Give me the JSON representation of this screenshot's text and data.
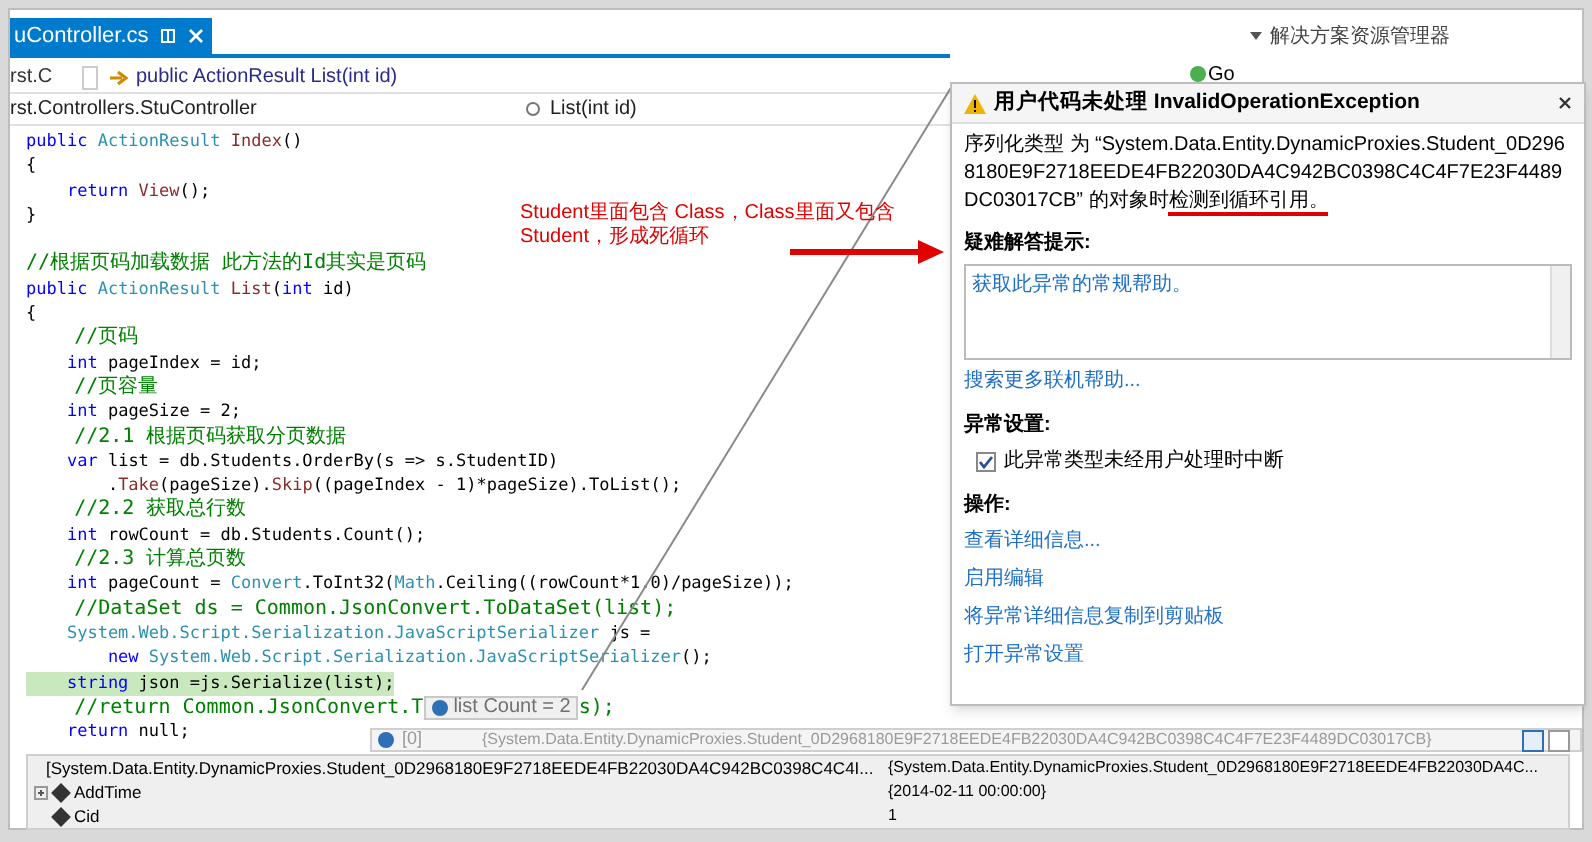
{
  "editor": {
    "tab": {
      "label": "uController.cs",
      "selected": true
    },
    "nav_bar_1": {
      "project": "rst.C",
      "member": "public ActionResult List(int id)"
    },
    "nav_bar_2": {
      "class": "rst.Controllers.StuController",
      "method": "List(int id)"
    },
    "code_lines": [
      {
        "current": false,
        "segments": [
          {
            "kind": "kw",
            "text": "public "
          },
          {
            "kind": "type",
            "text": "ActionResult "
          },
          {
            "kind": "method",
            "text": "Index"
          },
          {
            "kind": "plain",
            "text": "()"
          }
        ]
      },
      {
        "current": false,
        "segments": [
          {
            "kind": "plain",
            "text": "{"
          }
        ]
      },
      {
        "current": false,
        "segments": [
          {
            "kind": "kw",
            "text": "    return "
          },
          {
            "kind": "method",
            "text": "View"
          },
          {
            "kind": "plain",
            "text": "();"
          }
        ]
      },
      {
        "current": false,
        "segments": [
          {
            "kind": "plain",
            "text": "}"
          }
        ]
      },
      {
        "current": false
      },
      {
        "current": false,
        "segments": [
          {
            "kind": "comment",
            "text": "//根据页码加载数据 此方法的Id其实是页码"
          }
        ]
      },
      {
        "current": false,
        "segments": [
          {
            "kind": "kw",
            "text": "public "
          },
          {
            "kind": "type",
            "text": "ActionResult "
          },
          {
            "kind": "method",
            "text": "List"
          },
          {
            "kind": "plain",
            "text": "("
          },
          {
            "kind": "kw",
            "text": "int "
          },
          {
            "kind": "plain",
            "text": "id)"
          }
        ]
      },
      {
        "current": false,
        "segments": [
          {
            "kind": "plain",
            "text": "{"
          }
        ]
      },
      {
        "current": false,
        "segments": [
          {
            "kind": "comment",
            "text": "    //页码"
          }
        ]
      },
      {
        "current": false,
        "segments": [
          {
            "kind": "kw",
            "text": "    int "
          },
          {
            "kind": "plain",
            "text": "pageIndex = id;"
          }
        ]
      },
      {
        "current": false,
        "segments": [
          {
            "kind": "comment",
            "text": "    //页容量"
          }
        ]
      },
      {
        "current": false,
        "segments": [
          {
            "kind": "kw",
            "text": "    int "
          },
          {
            "kind": "plain",
            "text": "pageSize = 2;"
          }
        ]
      },
      {
        "current": false,
        "segments": [
          {
            "kind": "comment",
            "text": "    //2.1 根据页码获取分页数据"
          }
        ]
      },
      {
        "current": false,
        "segments": [
          {
            "kind": "kw",
            "text": "    var "
          },
          {
            "kind": "plain",
            "text": "list = db.Students.OrderBy(s => s.StudentID)"
          }
        ]
      },
      {
        "current": false,
        "segments": [
          {
            "kind": "plain",
            "text": "        ."
          },
          {
            "kind": "method",
            "text": "Take"
          },
          {
            "kind": "plain",
            "text": "(pageSize)."
          },
          {
            "kind": "method",
            "text": "Skip"
          },
          {
            "kind": "plain",
            "text": "((pageIndex - 1)*pageSize).ToList();"
          }
        ]
      },
      {
        "current": false,
        "segments": [
          {
            "kind": "comment",
            "text": "    //2.2 获取总行数"
          }
        ]
      },
      {
        "current": false,
        "segments": [
          {
            "kind": "kw",
            "text": "    int "
          },
          {
            "kind": "plain",
            "text": "rowCount = db.Students.Count();"
          }
        ]
      },
      {
        "current": false,
        "segments": [
          {
            "kind": "comment",
            "text": "    //2.3 计算总页数"
          }
        ]
      },
      {
        "current": false,
        "segments": [
          {
            "kind": "kw",
            "text": "    int "
          },
          {
            "kind": "plain",
            "text": "pageCount = "
          },
          {
            "kind": "type",
            "text": "Convert"
          },
          {
            "kind": "plain",
            "text": ".ToInt32("
          },
          {
            "kind": "type",
            "text": "Math"
          },
          {
            "kind": "plain",
            "text": ".Ceiling((rowCount*1.0)/pageSize));"
          }
        ]
      },
      {
        "current": false,
        "segments": [
          {
            "kind": "comment",
            "text": "    //DataSet ds = Common.JsonConvert.ToDataSet(list);"
          }
        ]
      },
      {
        "current": false,
        "segments": [
          {
            "kind": "type",
            "text": "    System.Web.Script.Serialization.JavaScriptSerializer "
          },
          {
            "kind": "plain",
            "text": "js ="
          }
        ]
      },
      {
        "current": false,
        "segments": [
          {
            "kind": "kw",
            "text": "        new "
          },
          {
            "kind": "type",
            "text": "System.Web.Script.Serialization.JavaScriptSerializer"
          },
          {
            "kind": "plain",
            "text": "();"
          }
        ]
      },
      {
        "current": true,
        "segments": [
          {
            "kind": "kw",
            "text": "    string "
          },
          {
            "kind": "plain",
            "text": "json =js.Serialize(list);"
          }
        ]
      },
      {
        "current": false,
        "segments": [
          {
            "kind": "comment",
            "text": "    //return Common.JsonConvert.T"
          },
          {
            "kind": "datatip",
            "text": "list Count = 2"
          },
          {
            "kind": "comment",
            "text": "s);"
          }
        ]
      },
      {
        "current": false,
        "segments": [
          {
            "kind": "kw",
            "text": "    return "
          },
          {
            "kind": "plain",
            "text": "null;"
          }
        ]
      }
    ]
  },
  "annotation": {
    "text": "Student里面包含 Class，Class里面又包含Student，形成死循环"
  },
  "datatip_item": {
    "name": "[0]",
    "value": "{System.Data.Entity.DynamicProxies.Student_0D2968180E9F2718EEDE4FB22030DA4C942BC0398C4C4F7E23F4489DC03017CB}"
  },
  "datatip_rows": [
    {
      "name": "[System.Data.Entity.DynamicProxies.Student_0D2968180E9F2718EEDE4FB22030DA4C942BC0398C4C4I...",
      "value": "{System.Data.Entity.DynamicProxies.Student_0D2968180E9F2718EEDE4FB22030DA4C...",
      "kind": "object"
    },
    {
      "name": "AddTime",
      "value": "{2014-02-11 00:00:00}",
      "kind": "property"
    },
    {
      "name": "Cid",
      "value": "1",
      "kind": "field"
    }
  ],
  "solution_explorer": {
    "title": "解决方案资源管理器",
    "toolbar_label": "Go"
  },
  "exception": {
    "title": "用户代码未处理 InvalidOperationException",
    "message": {
      "text": "序列化类型 为 “System.Data.Entity.DynamicProxies.Student_0D2968180E9F2718EEDE4FB22030DA4C942BC0398C4C4F7E23F4489DC03017CB” 的对象时",
      "marked": "检测到循环引用。"
    },
    "tips_label": "疑难解答提示:",
    "tips_link": "获取此异常的常规帮助。",
    "search_link": "搜索更多联机帮助...",
    "settings_label": "异常设置:",
    "settings_option": {
      "label": "此异常类型未经用户处理时中断",
      "checked": true
    },
    "actions_label": "操作:",
    "actions": [
      "查看详细信息...",
      "启用编辑",
      "将异常详细信息复制到剪贴板",
      "打开异常设置"
    ]
  }
}
